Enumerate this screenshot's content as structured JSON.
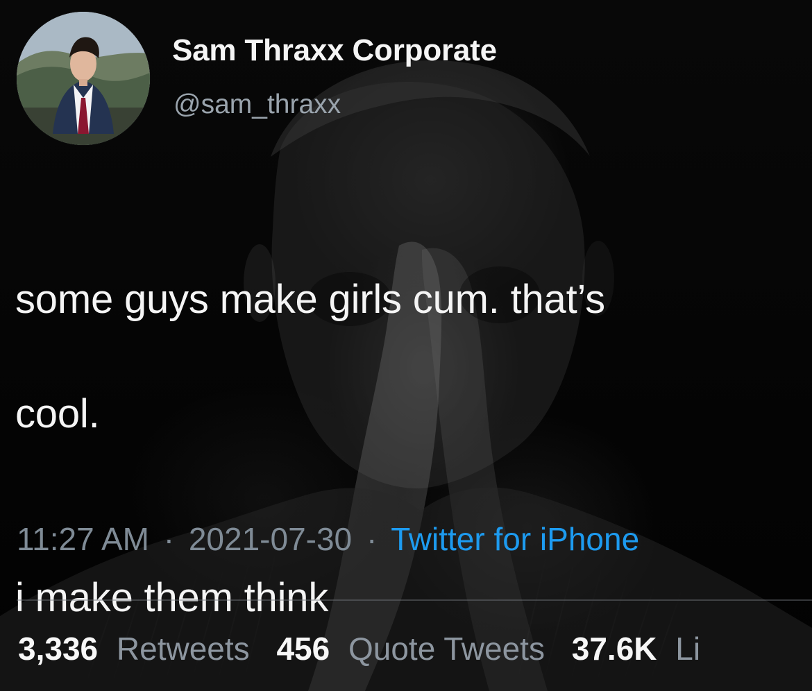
{
  "tweet": {
    "display_name": "Sam Thraxx Corporate",
    "username": "@sam_thraxx",
    "text_lines": [
      "some guys make girls cum. that’s",
      "cool.",
      "",
      "i make them think"
    ],
    "time": "11:27 AM",
    "date": "2021-07-30",
    "source": "Twitter for iPhone",
    "separator": "·",
    "stats": [
      {
        "count": "3,336",
        "label": "Retweets"
      },
      {
        "count": "456",
        "label": "Quote Tweets"
      },
      {
        "count": "37.6K",
        "label": "Li"
      }
    ]
  },
  "colors": {
    "background": "#000000",
    "text": "#f5f5f5",
    "secondary_text": "#9aa4ad",
    "link": "#1d9bf0"
  },
  "icons": {
    "avatar": "profile-avatar"
  }
}
